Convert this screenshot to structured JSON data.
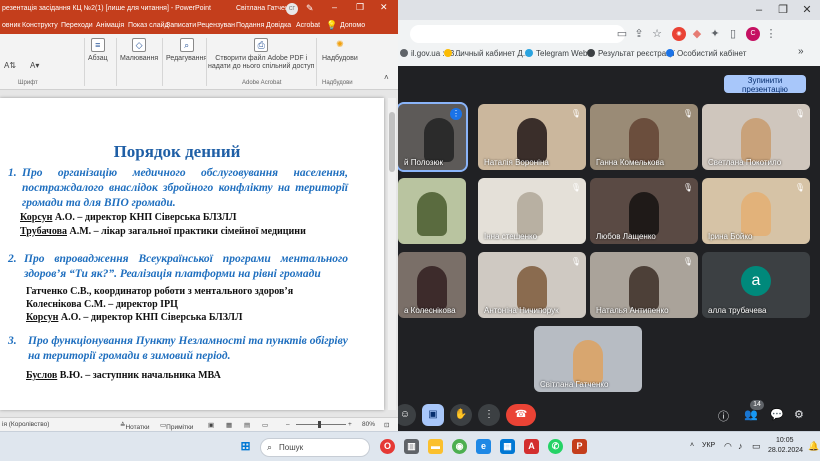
{
  "colors": {
    "ppt_accent": "#c43e1c",
    "slide_title": "#1f5fa6",
    "slide_item": "#1f6fbf",
    "meet_bg": "#202124",
    "end_call": "#ea4335",
    "avatar": "#00897b"
  },
  "ppt": {
    "title_file": "резентація засідання КЦ №2(1) [лише для читання] - PowerPoint",
    "title_user": "Світлана Гатченко",
    "user_initials": "СГ",
    "tabs": [
      "овник",
      "Конструкту",
      "Переходи",
      "Анімація",
      "Показ слайд",
      "Записати",
      "Рецензуван",
      "Подання",
      "Довідка",
      "Acrobat",
      "Допомо"
    ],
    "ribbon": {
      "font_group": "Шрифт",
      "paragraph": "Абзац",
      "drawing": "Малювання",
      "editing": "Редагування",
      "acrobat_btn_line1": "Створити файл Adobe PDF і",
      "acrobat_btn_line2": "надати до нього спільний доступ",
      "acrobat_group": "Adobe Acrobat",
      "addins_btn": "Надбудови",
      "addins_group": "Надбудови"
    },
    "status": {
      "language": "ія (Королівство)",
      "notes": "Нотатки",
      "comments": "Примітки",
      "zoom": "80%"
    }
  },
  "slide": {
    "title": "Порядок денний",
    "item1_num": "1.",
    "item1_text": "Про організацію медичного обслуговування населення, постраждалого внаслідок збройного конфлікту на території громади та для ВПО громади.",
    "item1_sub1_name": "Корсун",
    "item1_sub1_rest": " А.О. – директор КНП Сіверська БЛЗЛЛ",
    "item1_sub2_name": "Трубачова",
    "item1_sub2_rest": " А.М. – лікар загальної практики сімейної медицини",
    "item2_num": "2.",
    "item2_text": "Про впровадження Всеукраїнської програми ментального здоров’я “Ти як?”. Реалізація платформи на рівні громади",
    "item2_sub1": "Гатченко С.В., координатор роботи з ментального здоров’я",
    "item2_sub2": "Колеснікова С.М. – директор ІРЦ",
    "item2_sub3_name": "Корсун",
    "item2_sub3_rest": " А.О. – директор КНП Сіверська БЛЗЛЛ",
    "item3_num": "3.",
    "item3_text": "Про функціонування Пункту Незламності та пунктів обігріву на території громади в зимовий період.",
    "item3_sub1_name": "Буслов",
    "item3_sub1_rest": " В.Ю. – заступник начальника МВА"
  },
  "chrome": {
    "bookmarks": [
      {
        "label": "il.gov.ua :: В...",
        "color": "#5f6368"
      },
      {
        "label": "Личный кабинет Д...",
        "color": "#fbbc04"
      },
      {
        "label": "Telegram Web",
        "color": "#2aa3df"
      },
      {
        "label": "Результат реєстрації",
        "color": "#3c4043"
      },
      {
        "label": "Особистий кабінет",
        "color": "#1a73e8"
      }
    ],
    "more_bookmarks": "»"
  },
  "meet": {
    "stop_presenting": "Зупинити презентацію",
    "participants": [
      {
        "name": "й Полозюк",
        "initial": ""
      },
      {
        "name": "Наталія Вороніна",
        "initial": ""
      },
      {
        "name": "Ганна Комелькова",
        "initial": ""
      },
      {
        "name": "Светлана Покотило",
        "initial": ""
      },
      {
        "name": "",
        "initial": ""
      },
      {
        "name": "Інна стешенко",
        "initial": ""
      },
      {
        "name": "Любов Лащенко",
        "initial": ""
      },
      {
        "name": "Ірина Бойко",
        "initial": ""
      },
      {
        "name": "а Колеснікова",
        "initial": ""
      },
      {
        "name": "Антоніна Ничипорук",
        "initial": ""
      },
      {
        "name": "Наталья Антипенко",
        "initial": ""
      },
      {
        "name": "алла трубачева",
        "initial": "a"
      },
      {
        "name": "Світлана Гатченко",
        "initial": ""
      }
    ],
    "participant_count": "14"
  },
  "taskbar": {
    "search_placeholder": "Пошук",
    "lang": "УКР",
    "time": "10:05",
    "date": "28.02.2024"
  }
}
